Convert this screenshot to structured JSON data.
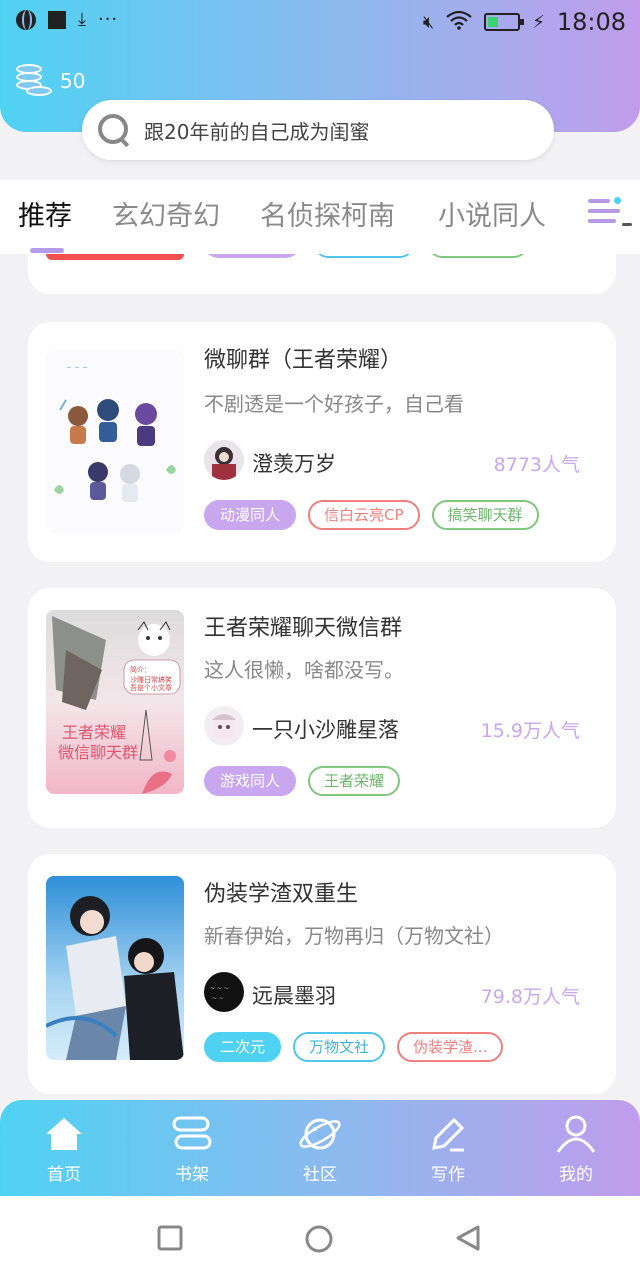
{
  "status_bar": {
    "time": "18:08",
    "battery_level": 0.35,
    "left_icons": [
      "globe-icon",
      "square-icon",
      "download-icon",
      "more-icon"
    ],
    "right_icons": [
      "mute-icon",
      "wifi-icon",
      "battery-icon",
      "charging-icon"
    ]
  },
  "header": {
    "coins": "50",
    "search_placeholder": "跟20年前的自己成为闺蜜"
  },
  "tabs": [
    {
      "label": "推荐",
      "active": true
    },
    {
      "label": "玄幻奇幻",
      "active": false
    },
    {
      "label": "名侦探柯南",
      "active": false
    },
    {
      "label": "小说同人",
      "active": false
    }
  ],
  "cards": [
    {
      "title": "微聊群（王者荣耀）",
      "desc": "不剧透是一个好孩子，自己看",
      "author": "澄羡万岁",
      "popularity": "8773人气",
      "tags": [
        {
          "label": "动漫同人",
          "style": "filled",
          "color": "#c9a7ef"
        },
        {
          "label": "信白云亮CP",
          "style": "outline",
          "color": "#f07f7f"
        },
        {
          "label": "搞笑聊天群",
          "style": "outline",
          "color": "#7fc67f"
        }
      ]
    },
    {
      "title": "王者荣耀聊天微信群",
      "desc": "这人很懒，啥都没写。",
      "author": "一只小沙雕星落",
      "popularity": "15.9万人气",
      "cover_text": "王者荣耀微信聊天群",
      "tags": [
        {
          "label": "游戏同人",
          "style": "filled",
          "color": "#c9a7ef"
        },
        {
          "label": "王者荣耀",
          "style": "outline",
          "color": "#7fc67f"
        }
      ]
    },
    {
      "title": "伪装学渣双重生",
      "desc": "新春伊始，万物再归（万物文社）",
      "author": "远晨墨羽",
      "popularity": "79.8万人气",
      "tags": [
        {
          "label": "二次元",
          "style": "filled",
          "color": "#4fd2f2"
        },
        {
          "label": "万物文社",
          "style": "outline",
          "color": "#4fc6e8"
        },
        {
          "label": "伪装学渣...",
          "style": "outline",
          "color": "#f07f7f"
        }
      ]
    }
  ],
  "bottom_nav": [
    {
      "label": "首页",
      "icon": "home-icon",
      "active": true
    },
    {
      "label": "书架",
      "icon": "bookshelf-icon",
      "active": false
    },
    {
      "label": "社区",
      "icon": "planet-icon",
      "active": false
    },
    {
      "label": "写作",
      "icon": "pen-icon",
      "active": false
    },
    {
      "label": "我的",
      "icon": "user-icon",
      "active": false
    }
  ],
  "system_nav": [
    "recent-apps-icon",
    "home-circle-icon",
    "back-icon"
  ]
}
